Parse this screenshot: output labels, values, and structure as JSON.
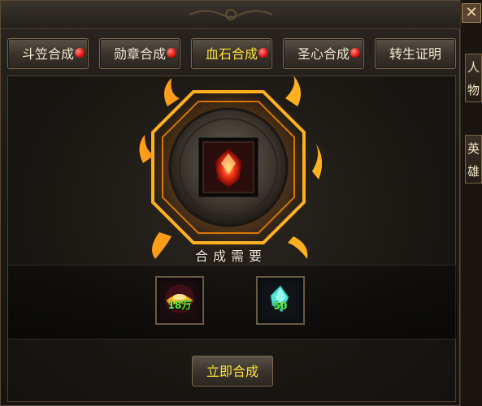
{
  "tabs": [
    {
      "label": "斗笠合成",
      "dot": true
    },
    {
      "label": "勋章合成",
      "dot": true
    },
    {
      "label": "血石合成",
      "dot": true,
      "active": true
    },
    {
      "label": "圣心合成",
      "dot": true
    },
    {
      "label": "转生证明",
      "dot": false
    }
  ],
  "requirement_label": "合成需要",
  "materials": [
    {
      "icon": "gold-ingot-icon",
      "count": "18万"
    },
    {
      "icon": "crystal-icon",
      "count": "50"
    }
  ],
  "craft_button": "立即合成",
  "side": {
    "close_glyph": "✕",
    "tab1": "人物",
    "tab2": "英雄"
  },
  "colors": {
    "active_tab": "#ffe23b",
    "count_text": "#53ff3c",
    "notify_dot": "#e01010"
  }
}
